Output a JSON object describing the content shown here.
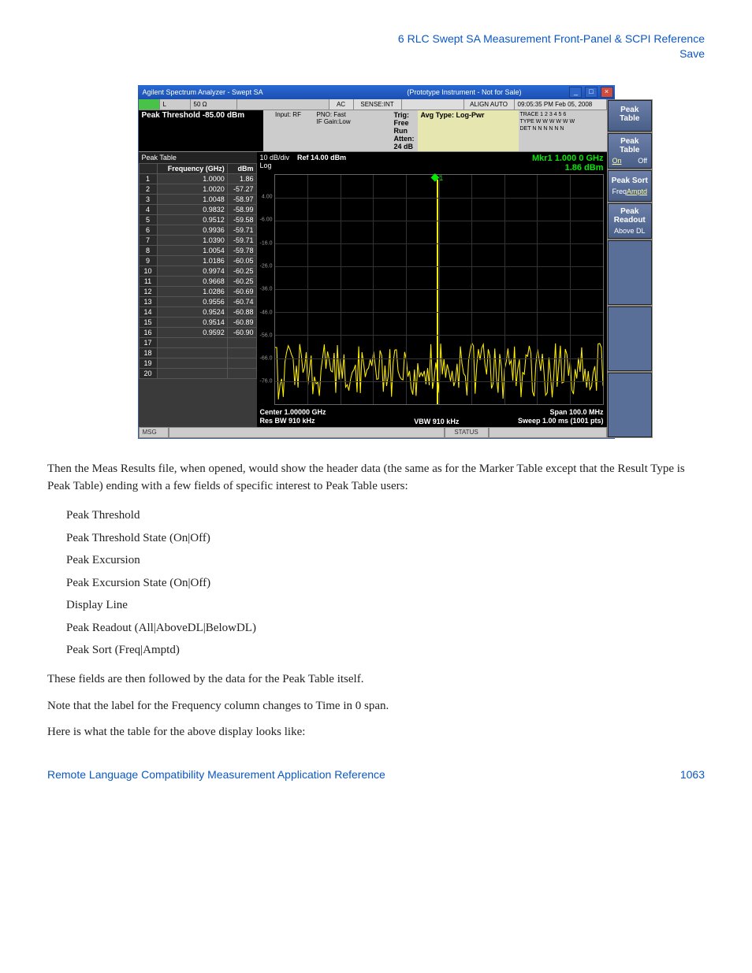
{
  "header": {
    "line1": "6  RLC Swept SA Measurement Front-Panel & SCPI Reference",
    "line2": "Save"
  },
  "screenshot": {
    "titlebar": {
      "title": "Agilent Spectrum Analyzer - Swept SA",
      "proto": "(Prototype Instrument - Not for Sale)"
    },
    "infobar": {
      "row1": {
        "c2": "L",
        "c3": "50 Ω",
        "ac": "AC",
        "sense": "SENSE:INT",
        "align": "ALIGN AUTO",
        "time": "09:05:35 PM Feb 05, 2008"
      },
      "row2": {
        "peak_threshold": "Peak Threshold  -85.00 dBm",
        "input": "Input: RF",
        "pno": "PNO: Fast",
        "ifgain": "IF Gain:Low",
        "trig": "Trig: Free Run",
        "atten": "Atten: 24 dB",
        "avg": "Avg Type: Log-Pwr",
        "trace_l1": "TRACE 1 2 3 4 5 6",
        "trace_l2": "TYPE W W W W W W",
        "trace_l3": "DET N N N N N N"
      }
    },
    "peak_table": {
      "title": "Peak Table",
      "headers": [
        "",
        "Frequency (GHz)",
        "dBm"
      ],
      "rows": [
        [
          "1",
          "1.0000",
          "1.86"
        ],
        [
          "2",
          "1.0020",
          "-57.27"
        ],
        [
          "3",
          "1.0048",
          "-58.97"
        ],
        [
          "4",
          "0.9832",
          "-58.99"
        ],
        [
          "5",
          "0.9512",
          "-59.58"
        ],
        [
          "6",
          "0.9936",
          "-59.71"
        ],
        [
          "7",
          "1.0390",
          "-59.71"
        ],
        [
          "8",
          "1.0054",
          "-59.78"
        ],
        [
          "9",
          "1.0186",
          "-60.05"
        ],
        [
          "10",
          "0.9974",
          "-60.25"
        ],
        [
          "11",
          "0.9668",
          "-60.25"
        ],
        [
          "12",
          "1.0286",
          "-60.69"
        ],
        [
          "13",
          "0.9556",
          "-60.74"
        ],
        [
          "14",
          "0.9524",
          "-60.88"
        ],
        [
          "15",
          "0.9514",
          "-60.89"
        ],
        [
          "16",
          "0.9592",
          "-60.90"
        ],
        [
          "17",
          "",
          ""
        ],
        [
          "18",
          "",
          ""
        ],
        [
          "19",
          "",
          ""
        ],
        [
          "20",
          "",
          ""
        ]
      ]
    },
    "plot": {
      "top_left_l1": "10 dB/div",
      "top_left_l2": "Log",
      "ref": "Ref 14.00 dBm",
      "mkr_l1": "Mkr1 1.000 0 GHz",
      "mkr_l2": "1.86 dBm",
      "mkr_num": "1",
      "yticks": [
        "4.00",
        "-6.00",
        "-16.0",
        "-26.0",
        "-36.0",
        "-46.0",
        "-56.0",
        "-66.0",
        "-76.0"
      ],
      "footer_left_l1": "Center 1.00000 GHz",
      "footer_left_l2": "Res BW 910 kHz",
      "footer_mid": "VBW 910 kHz",
      "footer_right_l1": "Span 100.0 MHz",
      "footer_right_l2": "Sweep  1.00 ms (1001 pts)"
    },
    "softkeys": {
      "menu_title": "Peak Table",
      "k1": {
        "title": "Peak Table",
        "on": "On",
        "off": "Off"
      },
      "k2": {
        "title": "Peak Sort",
        "left": "Freq",
        "right": "Amptd"
      },
      "k3": {
        "title": "Peak Readout",
        "sub": "Above DL"
      }
    },
    "statusbar": {
      "msg": "MSG",
      "status": "STATUS"
    }
  },
  "chart_data": {
    "type": "line",
    "description": "Spectrum analyzer swept SA trace with single large peak at center frequency and noise floor; Peak Table listing 16 peaks.",
    "x_center_GHz": 1.0,
    "x_span_MHz": 100.0,
    "y_ref_dBm": 14.0,
    "y_scale_dB_per_div": 10,
    "y_divisions": 10,
    "y_range_dBm": [
      -86,
      14
    ],
    "resolution_bw_kHz": 910,
    "video_bw_kHz": 910,
    "sweep_time_ms": 1.0,
    "sweep_points": 1001,
    "marker": {
      "n": 1,
      "freq_GHz": 1.0,
      "amplitude_dBm": 1.86
    },
    "peak_threshold_dBm": -85.0,
    "peaks": [
      {
        "rank": 1,
        "freq_GHz": 1.0,
        "dBm": 1.86
      },
      {
        "rank": 2,
        "freq_GHz": 1.002,
        "dBm": -57.27
      },
      {
        "rank": 3,
        "freq_GHz": 1.0048,
        "dBm": -58.97
      },
      {
        "rank": 4,
        "freq_GHz": 0.9832,
        "dBm": -58.99
      },
      {
        "rank": 5,
        "freq_GHz": 0.9512,
        "dBm": -59.58
      },
      {
        "rank": 6,
        "freq_GHz": 0.9936,
        "dBm": -59.71
      },
      {
        "rank": 7,
        "freq_GHz": 1.039,
        "dBm": -59.71
      },
      {
        "rank": 8,
        "freq_GHz": 1.0054,
        "dBm": -59.78
      },
      {
        "rank": 9,
        "freq_GHz": 1.0186,
        "dBm": -60.05
      },
      {
        "rank": 10,
        "freq_GHz": 0.9974,
        "dBm": -60.25
      },
      {
        "rank": 11,
        "freq_GHz": 0.9668,
        "dBm": -60.25
      },
      {
        "rank": 12,
        "freq_GHz": 1.0286,
        "dBm": -60.69
      },
      {
        "rank": 13,
        "freq_GHz": 0.9556,
        "dBm": -60.74
      },
      {
        "rank": 14,
        "freq_GHz": 0.9524,
        "dBm": -60.88
      },
      {
        "rank": 15,
        "freq_GHz": 0.9514,
        "dBm": -60.89
      },
      {
        "rank": 16,
        "freq_GHz": 0.9592,
        "dBm": -60.9
      }
    ],
    "noise_floor_approx_dBm": -68
  },
  "body": {
    "p1": "Then the Meas Results file, when opened, would show the header data (the same as for the Marker Table except that the Result Type is Peak Table) ending with a few fields of specific interest to Peak Table users:",
    "list": [
      "Peak Threshold",
      "Peak Threshold State (On|Off)",
      "Peak Excursion",
      "Peak Excursion State (On|Off)",
      "Display Line",
      "Peak Readout (All|AboveDL|BelowDL)",
      "Peak Sort (Freq|Amptd)"
    ],
    "p2": "These fields are then followed by the data for the Peak Table itself.",
    "p3": "Note that the label for the Frequency column changes to Time in 0 span.",
    "p4": "Here is what the table for the above display looks like:"
  },
  "footer": {
    "left": "Remote Language Compatibility Measurement Application Reference",
    "right": "1063"
  }
}
